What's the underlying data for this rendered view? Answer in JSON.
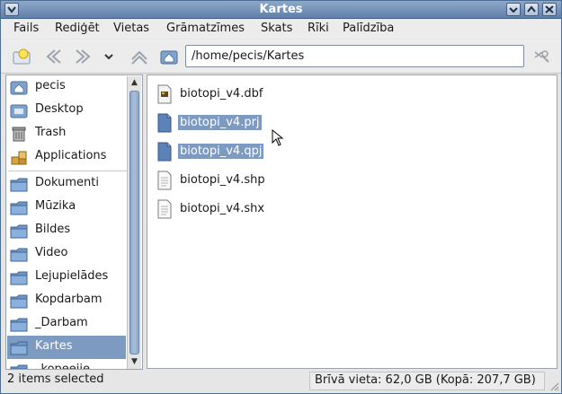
{
  "window": {
    "title": "Kartes"
  },
  "menu": [
    "Fails",
    "Rediģēt",
    "Vietas",
    "Grāmatzīmes",
    "Skats",
    "Rīki",
    "Palīdzība"
  ],
  "location": {
    "path": "/home/pecis/Kartes"
  },
  "sidebar": {
    "places": [
      {
        "label": "pecis",
        "icon": "home-folder-icon"
      },
      {
        "label": "Desktop",
        "icon": "desktop-icon"
      },
      {
        "label": "Trash",
        "icon": "trash-icon"
      },
      {
        "label": "Applications",
        "icon": "applications-icon"
      }
    ],
    "bookmarks": [
      {
        "label": "Dokumenti"
      },
      {
        "label": "Mūzika"
      },
      {
        "label": "Bildes"
      },
      {
        "label": "Video"
      },
      {
        "label": "Lejupielādes"
      },
      {
        "label": "Kopdarbam"
      },
      {
        "label": "_Darbam"
      },
      {
        "label": "Kartes",
        "selected": true
      },
      {
        "label": "_kopeejie"
      }
    ]
  },
  "files": [
    {
      "name": "biotopi_v4.dbf",
      "icon": "dbf-file-icon",
      "selected": false
    },
    {
      "name": "biotopi_v4.prj",
      "icon": "blue-document-icon",
      "selected": true
    },
    {
      "name": "biotopi_v4.qpj",
      "icon": "blue-document-icon",
      "selected": true
    },
    {
      "name": "biotopi_v4.shp",
      "icon": "text-document-icon",
      "selected": false
    },
    {
      "name": "biotopi_v4.shx",
      "icon": "text-document-icon",
      "selected": false
    }
  ],
  "status": {
    "selection": "2 items selected",
    "free_space": "Brīvā vieta: 62,0 GB (Kopā: 207,7 GB)"
  },
  "colors": {
    "accent": "#7d9ac1",
    "titlebar": "#6f8db5"
  }
}
